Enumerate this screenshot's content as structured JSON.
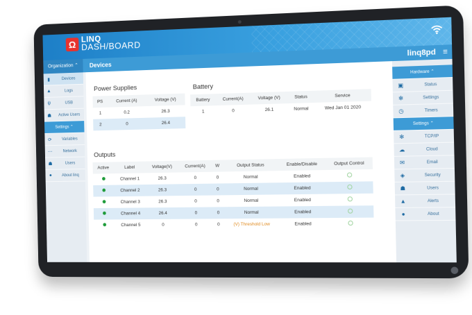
{
  "header": {
    "brand_line1": "LINQ",
    "brand_line2": "DASH/BOARD",
    "wifi_icon": "wifi-icon",
    "accent_color": "#3aa1e0"
  },
  "subheader": {
    "organization_label": "Organization",
    "page_title": "Devices",
    "username": "linq8pd"
  },
  "left_sidebar": {
    "items": [
      {
        "label": "Devices",
        "icon": "devices-icon"
      },
      {
        "label": "Logs",
        "icon": "logs-icon"
      },
      {
        "label": "USB",
        "icon": "usb-icon"
      },
      {
        "label": "Active Users",
        "icon": "users-icon"
      }
    ],
    "settings_label": "Settings",
    "settings_items": [
      {
        "label": "Variables",
        "icon": "variables-icon"
      },
      {
        "label": "Network",
        "icon": "network-icon"
      },
      {
        "label": "Users",
        "icon": "users-icon"
      },
      {
        "label": "About linq",
        "icon": "info-icon"
      }
    ]
  },
  "power_supplies": {
    "title": "Power Supplies",
    "headers": [
      "PS",
      "Current (A)",
      "Voltage (V)"
    ],
    "rows": [
      [
        "1",
        "0.2",
        "26.3"
      ],
      [
        "2",
        "0",
        "26.4"
      ]
    ]
  },
  "battery": {
    "title": "Battery",
    "headers": [
      "Battery",
      "Current(A)",
      "Voltage (V)",
      "Status",
      "Service"
    ],
    "rows": [
      [
        "1",
        "0",
        "26.1",
        "Normal",
        "Wed Jan 01 2020"
      ]
    ]
  },
  "outputs": {
    "title": "Outputs",
    "headers": [
      "Active",
      "Label",
      "Voltage(V)",
      "Current(A)",
      "W",
      "Output Status",
      "Enable/Disable",
      "Output Control"
    ],
    "rows": [
      {
        "label": "Channel 1",
        "voltage": "26.3",
        "current": "0",
        "w": "0",
        "status": "Normal",
        "enable": "Enabled"
      },
      {
        "label": "Channel 2",
        "voltage": "26.3",
        "current": "0",
        "w": "0",
        "status": "Normal",
        "enable": "Enabled"
      },
      {
        "label": "Channel 3",
        "voltage": "26.3",
        "current": "0",
        "w": "0",
        "status": "Normal",
        "enable": "Enabled"
      },
      {
        "label": "Channel 4",
        "voltage": "26.4",
        "current": "0",
        "w": "0",
        "status": "Normal",
        "enable": "Enabled"
      },
      {
        "label": "Channel 5",
        "voltage": "0",
        "current": "0",
        "w": "0",
        "status": "(V) Threshold Low",
        "enable": "Enabled"
      }
    ]
  },
  "right_sidebar": {
    "hardware_label": "Hardware",
    "hardware_items": [
      {
        "label": "Status",
        "icon": "status-icon"
      },
      {
        "label": "Settings",
        "icon": "gear-icon"
      },
      {
        "label": "Timers",
        "icon": "clock-icon"
      }
    ],
    "settings_label": "Settings",
    "settings_items": [
      {
        "label": "TCP/IP",
        "icon": "gear-icon"
      },
      {
        "label": "Cloud",
        "icon": "cloud-icon"
      },
      {
        "label": "Email",
        "icon": "email-icon"
      },
      {
        "label": "Security",
        "icon": "shield-icon"
      },
      {
        "label": "Users",
        "icon": "users-icon"
      },
      {
        "label": "Alerts",
        "icon": "alert-icon"
      },
      {
        "label": "About",
        "icon": "info-icon"
      }
    ]
  }
}
